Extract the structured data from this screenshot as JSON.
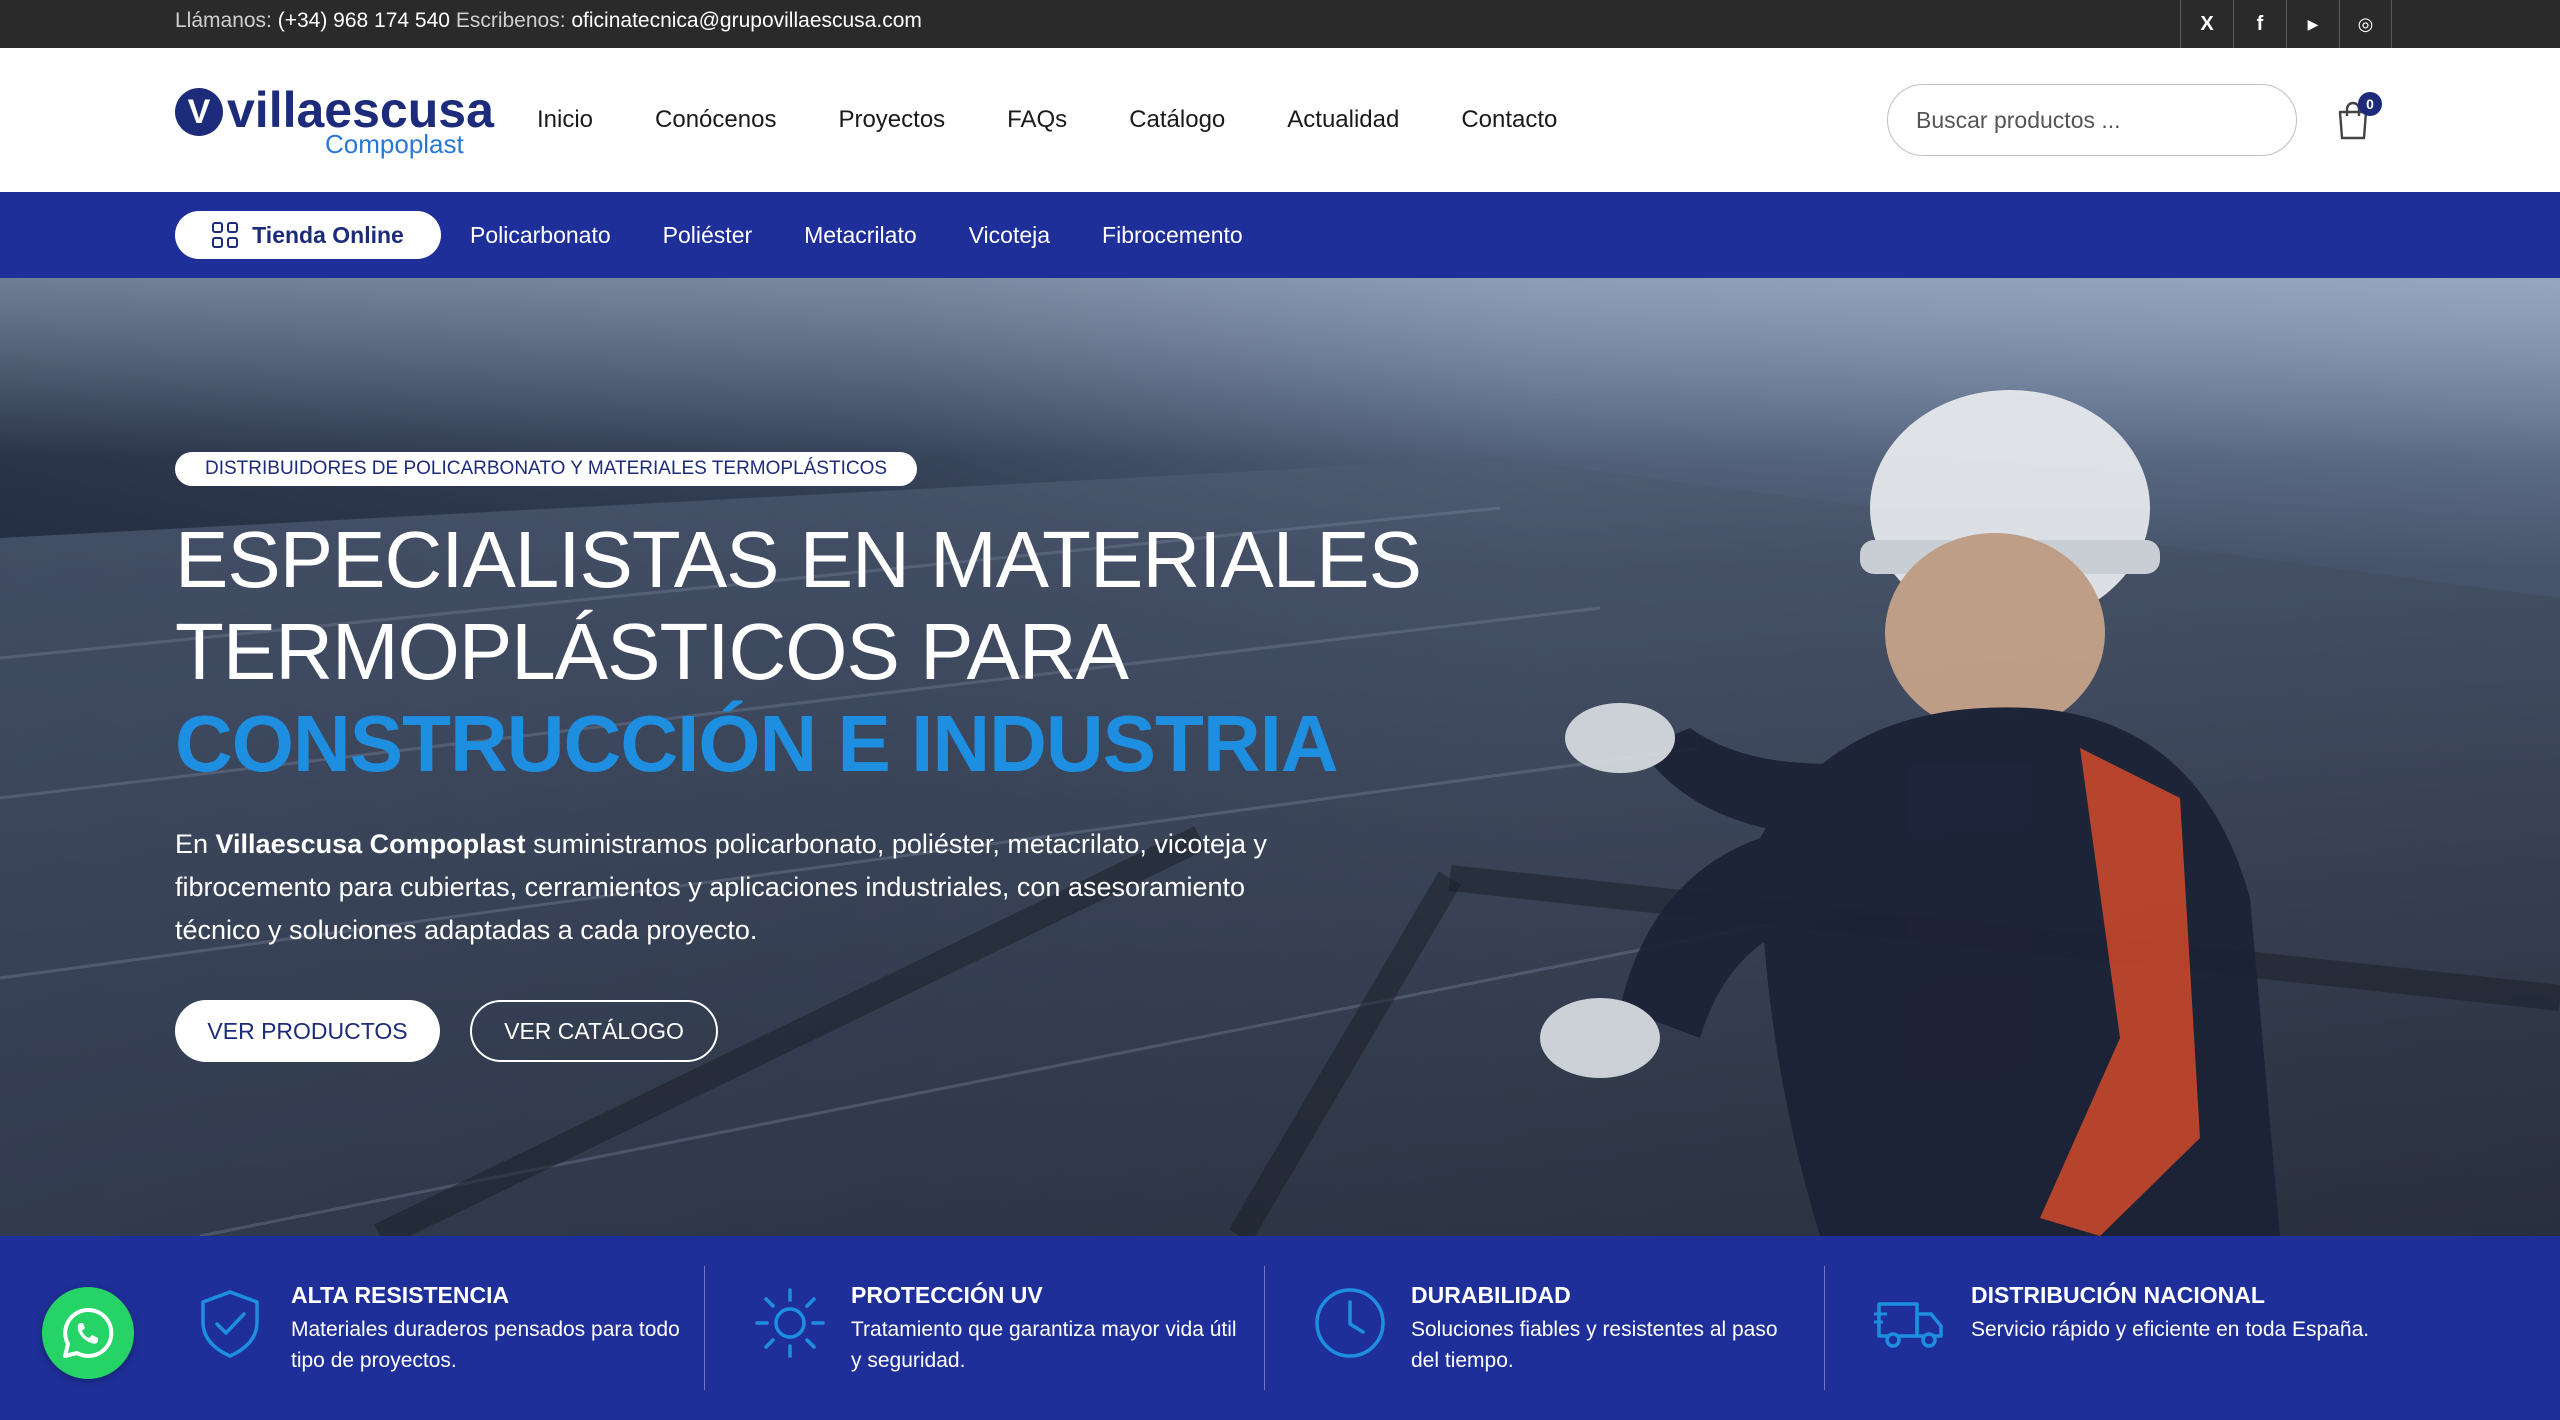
{
  "topbar": {
    "call_label": "Llámanos:",
    "phone": "(+34) 968 174 540",
    "write_label": "Escribenos:",
    "email": "oficinatecnica@grupovillaescusa.com",
    "socials": [
      {
        "icon": "x-icon",
        "glyph": "X"
      },
      {
        "icon": "facebook-icon",
        "glyph": "f"
      },
      {
        "icon": "youtube-icon",
        "glyph": "▶"
      },
      {
        "icon": "instagram-icon",
        "glyph": "◎"
      }
    ]
  },
  "header": {
    "logo_main": "villaescusa",
    "logo_sub": "Compoplast",
    "nav": [
      "Inicio",
      "Conócenos",
      "Proyectos",
      "FAQs",
      "Catálogo",
      "Actualidad",
      "Contacto"
    ],
    "search_placeholder": "Buscar productos ...",
    "cart_count": "0"
  },
  "categories": {
    "shop_label": "Tienda Online",
    "items": [
      "Policarbonato",
      "Poliéster",
      "Metacrilato",
      "Vicoteja",
      "Fibrocemento"
    ]
  },
  "hero": {
    "badge": "DISTRIBUIDORES DE POLICARBONATO Y MATERIALES TERMOPLÁSTICOS",
    "title_line1": "ESPECIALISTAS EN MATERIALES",
    "title_line2": "TERMOPLÁSTICOS PARA",
    "title_accent": "CONSTRUCCIÓN E INDUSTRIA",
    "desc_prefix": "En ",
    "desc_brand": "Villaescusa Compoplast",
    "desc_rest": " suministramos policarbonato, poliéster, metacrilato, vicoteja y fibrocemento para cubiertas, cerramientos y aplicaciones industriales, con asesoramiento técnico y soluciones adaptadas a cada proyecto.",
    "btn_products": "VER PRODUCTOS",
    "btn_catalog": "VER CATÁLOGO"
  },
  "features": [
    {
      "icon": "shield-check-icon",
      "title": "ALTA RESISTENCIA",
      "desc": "Materiales duraderos pensados para todo tipo de proyectos."
    },
    {
      "icon": "sun-icon",
      "title": "PROTECCIÓN UV",
      "desc": "Tratamiento que garantiza mayor vida útil y seguridad."
    },
    {
      "icon": "clock-icon",
      "title": "DURABILIDAD",
      "desc": "Soluciones fiables y resistentes al paso del tiempo."
    },
    {
      "icon": "truck-icon",
      "title": "DISTRIBUCIÓN NACIONAL",
      "desc": "Servicio rápido y eficiente en toda España."
    }
  ],
  "colors": {
    "brand_navy": "#1c2b7a",
    "brand_blue_bar": "#1f2f99",
    "accent_blue": "#1e8fe0",
    "whatsapp": "#25d366"
  }
}
